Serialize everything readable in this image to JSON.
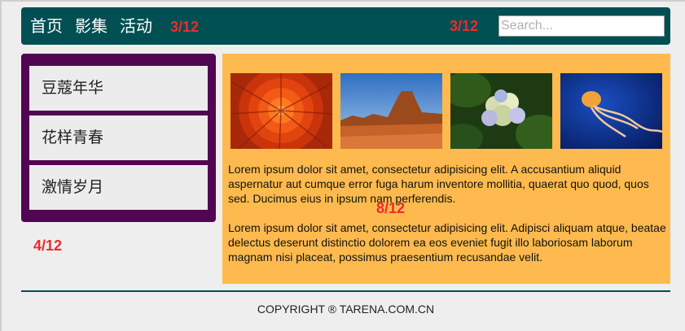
{
  "header": {
    "nav": [
      "首页",
      "影集",
      "活动"
    ],
    "grid_label_left": "3/12",
    "grid_label_right": "3/12",
    "search_placeholder": "Search..."
  },
  "sidebar": {
    "items": [
      "豆蔻年华",
      "花样青春",
      "激情岁月"
    ],
    "grid_label": "4/12"
  },
  "main": {
    "images": [
      {
        "icon": "red-chrysanthemum-flower-photo"
      },
      {
        "icon": "desert-canyon-photo"
      },
      {
        "icon": "hydrangea-photo"
      },
      {
        "icon": "jellyfish-photo"
      }
    ],
    "paragraphs": [
      "Lorem ipsum dolor sit amet, consectetur adipisicing elit. A accusantium aliquid aspernatur aut cumque error fuga harum inventore mollitia, quaerat quo quod, quos sed. Ducimus eius in ipsum nam perferendis.",
      "Lorem ipsum dolor sit amet, consectetur adipisicing elit. Adipisci aliquam atque, beatae delectus deserunt distinctio dolorem ea eos eveniet fugit illo laboriosam laborum magnam nisi placeat, possimus praesentium recusandae velit."
    ],
    "grid_label": "8/12"
  },
  "footer": {
    "copyright": "COPYRIGHT ® TARENA.COM.CN"
  },
  "colors": {
    "header_bg": "#004f53",
    "sidebar_bg": "#520552",
    "main_bg": "#feba4e",
    "grid_label": "#ee2b2b"
  }
}
